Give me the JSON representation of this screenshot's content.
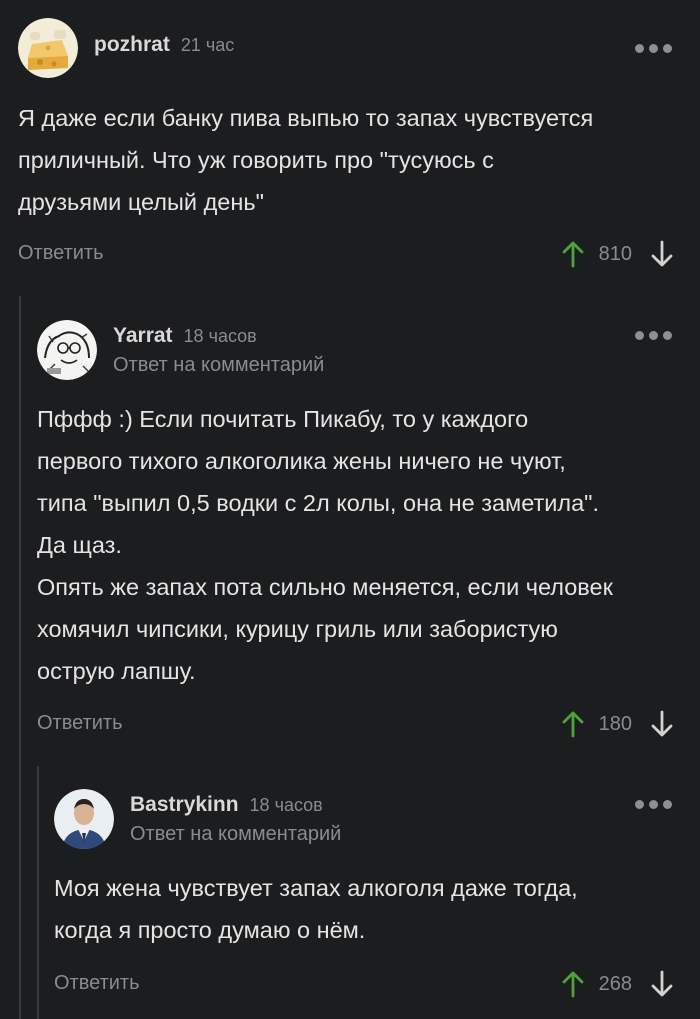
{
  "comments": [
    {
      "username": "pozhrat",
      "time": "21 час",
      "reply_note": "",
      "text": "Я даже если банку пива выпью то запах чувствуется\nприличный. Что уж говорить про \"тусуюсь с\nдрузьями целый день\"",
      "reply_label": "Ответить",
      "votes": "810",
      "avatar_icon": "cheese-avatar"
    },
    {
      "username": "Yarrat",
      "time": "18 часов",
      "reply_note": "Ответ на комментарий",
      "text": "Пффф :) Если почитать Пикабу, то у каждого\nпервого тихого алкоголика жены ничего не чуют,\nтипа \"выпил 0,5 водки с 2л колы, она не заметила\".\nДа щаз.\nОпять же запах пота сильно меняется, если человек\nхомячил чипсики, курицу гриль или забористую\nострую лапшу.",
      "reply_label": "Ответить",
      "votes": "180",
      "avatar_icon": "sketch-portrait-avatar"
    },
    {
      "username": "Bastrykinn",
      "time": "18 часов",
      "reply_note": "Ответ на комментарий",
      "text": "Моя жена чувствует запах алкоголя даже тогда,\nкогда я просто думаю о нём.",
      "reply_label": "Ответить",
      "votes": "268",
      "avatar_icon": "uniform-portrait-avatar"
    }
  ],
  "colors": {
    "background": "#1c1d1f",
    "upvote": "#4fa33a",
    "muted": "#8a8b8d"
  }
}
